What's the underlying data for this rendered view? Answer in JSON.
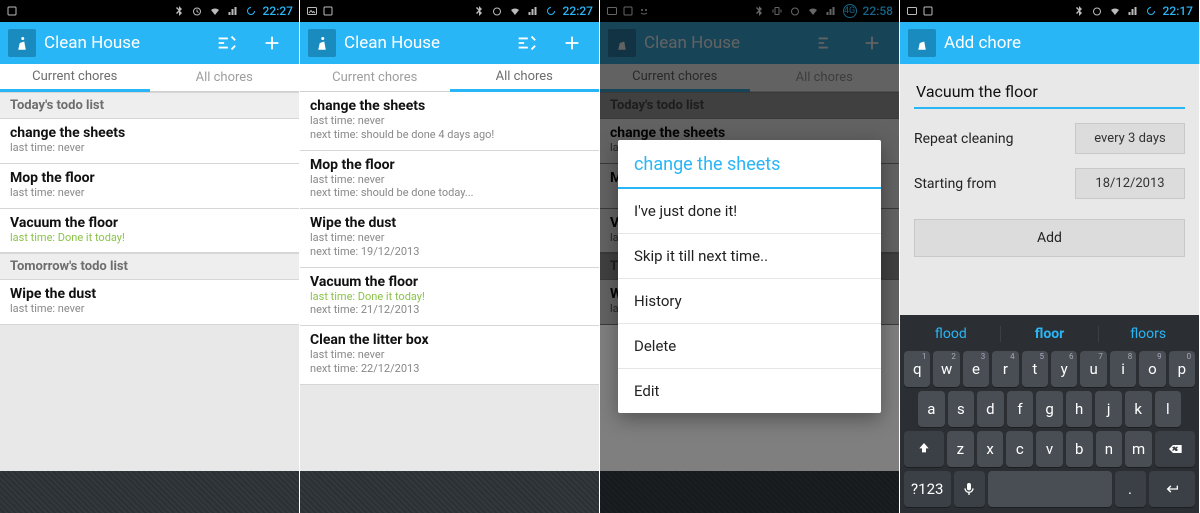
{
  "status": {
    "time_a": "22:27",
    "time_b": "22:27",
    "time_c": "22:58",
    "time_d": "22:17",
    "net_label": "4G"
  },
  "app": {
    "title": "Clean House",
    "add_title": "Add chore",
    "tabs": {
      "current": "Current chores",
      "all": "All chores"
    }
  },
  "s1": {
    "sections": [
      {
        "header": "Today's todo list",
        "items": [
          {
            "name": "change the sheets",
            "meta1": "last time: never"
          },
          {
            "name": "Mop the floor",
            "meta1": "last time: never"
          },
          {
            "name": "Vacuum the floor",
            "meta1": "last time: Done it today!",
            "done": true
          }
        ]
      },
      {
        "header": "Tomorrow's todo list",
        "items": [
          {
            "name": "Wipe the dust",
            "meta1": "last time: never"
          }
        ]
      }
    ]
  },
  "s2": {
    "items": [
      {
        "name": "change the sheets",
        "meta1": "last time: never",
        "meta2": "next time: should be done 4 days ago!"
      },
      {
        "name": "Mop the floor",
        "meta1": "last time: never",
        "meta2": "next time: should be done today..."
      },
      {
        "name": "Wipe the dust",
        "meta1": "last time: never",
        "meta2": "next time: 19/12/2013"
      },
      {
        "name": "Vacuum the floor",
        "meta1": "last time: Done it today!",
        "meta2": "next time: 21/12/2013",
        "done": true
      },
      {
        "name": "Clean the litter box",
        "meta1": "last time: never",
        "meta2": "next time: 22/12/2013"
      }
    ]
  },
  "s3": {
    "sections": [
      {
        "header": "Today's todo list",
        "items": [
          {
            "name": "change the sheets",
            "meta1": "last time: never"
          },
          {
            "name": "M",
            "meta1": ""
          },
          {
            "name": "V",
            "meta1": "la"
          }
        ]
      },
      {
        "header": "T",
        "items": [
          {
            "name": "W",
            "meta1": "la"
          }
        ]
      }
    ],
    "dialog": {
      "title": "change the sheets",
      "options": [
        "I've just done it!",
        "Skip it till next time..",
        "History",
        "Delete",
        "Edit"
      ]
    }
  },
  "s4": {
    "chore_value": "Vacuum the floor",
    "repeat_label": "Repeat cleaning",
    "repeat_value": "every 3 days",
    "starting_label": "Starting from",
    "starting_value": "18/12/2013",
    "add_label": "Add",
    "suggestions": [
      "flood",
      "floor",
      "floors"
    ],
    "rows": {
      "r1": [
        "q",
        "w",
        "e",
        "r",
        "t",
        "y",
        "u",
        "i",
        "o",
        "p"
      ],
      "r1_hints": [
        "1",
        "2",
        "3",
        "4",
        "5",
        "6",
        "7",
        "8",
        "9",
        "0"
      ],
      "r2": [
        "a",
        "s",
        "d",
        "f",
        "g",
        "h",
        "j",
        "k",
        "l"
      ],
      "r3": [
        "z",
        "x",
        "c",
        "v",
        "b",
        "n",
        "m"
      ]
    },
    "sym_label": "?123",
    "period": "."
  }
}
